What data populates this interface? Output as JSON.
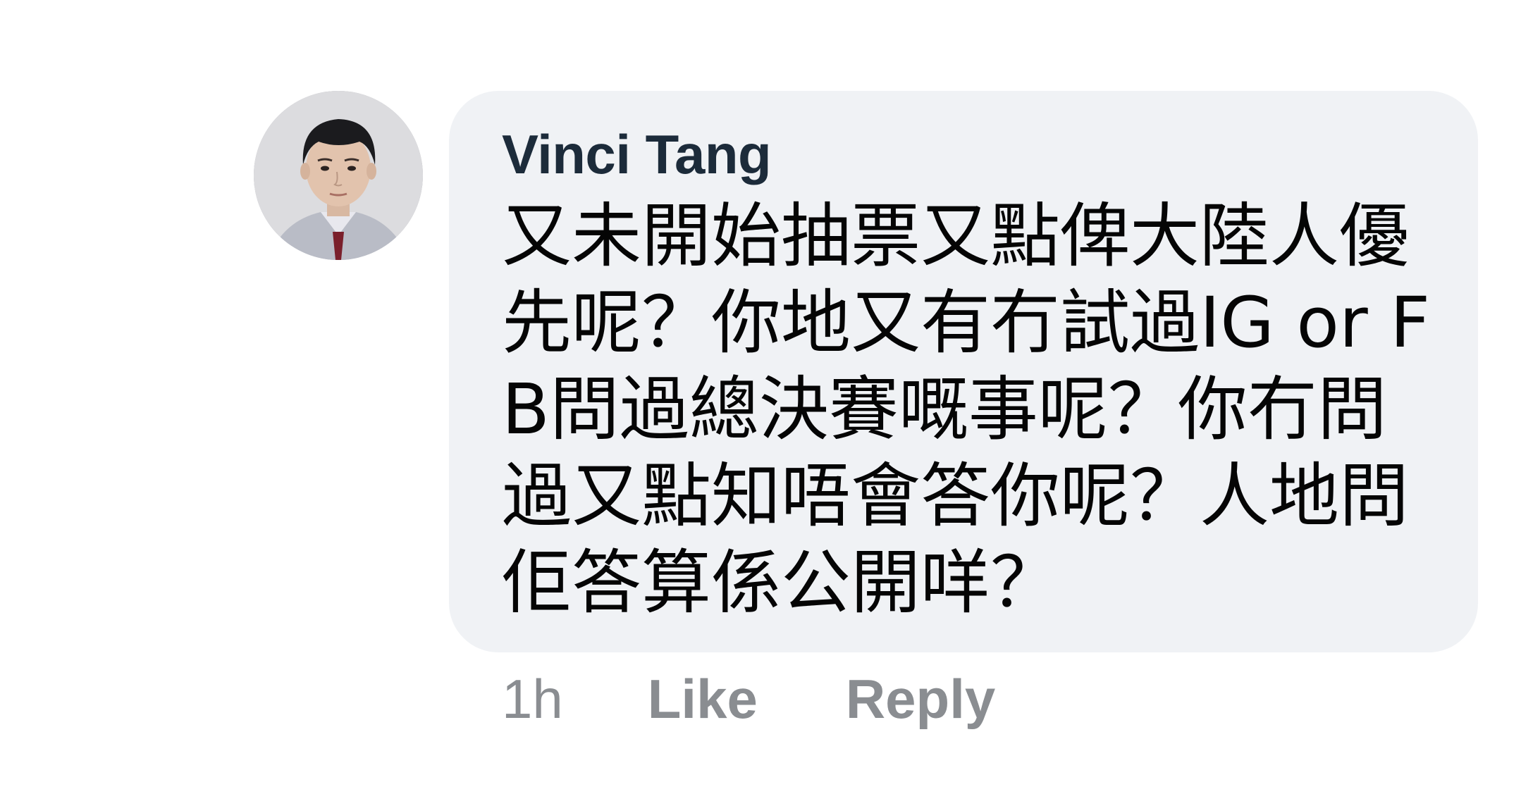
{
  "comment": {
    "author": "Vinci Tang",
    "text": "又未開始抽票又點俾大陸人優先呢？你地又有冇試過IG or FB問過總決賽嘅事呢？你冇問過又點知唔會答你呢？人地問佢答算係公開咩？",
    "bubble_color": "#f0f2f5"
  },
  "actions": {
    "timestamp": "1h",
    "like_label": "Like",
    "reply_label": "Reply",
    "color": "#8a8d91"
  },
  "avatar": {
    "icon": "user-avatar-photo"
  }
}
